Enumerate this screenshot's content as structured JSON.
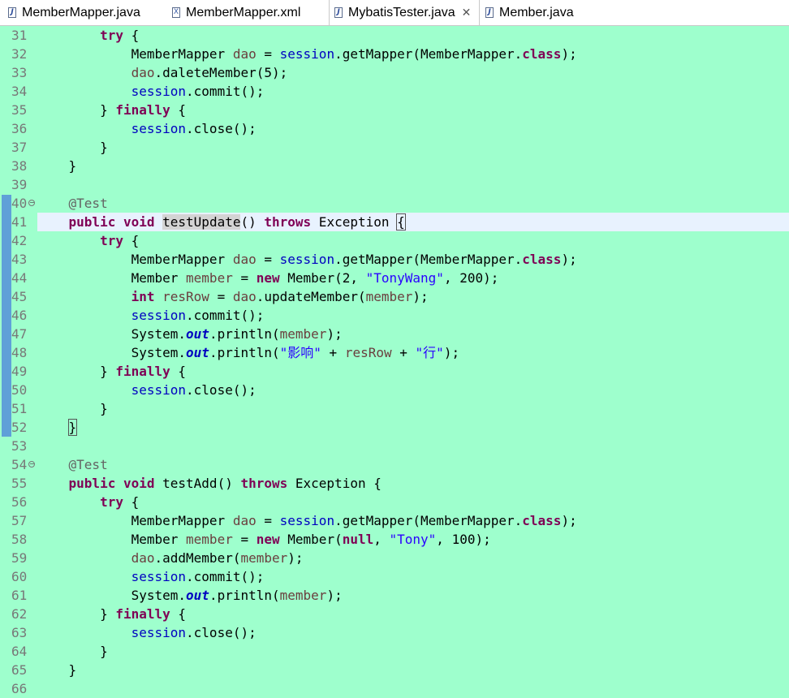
{
  "tabs": [
    {
      "label": "MemberMapper.java",
      "icon": "java-file-icon",
      "active": false,
      "closable": false
    },
    {
      "label": "MemberMapper.xml",
      "icon": "xml-file-icon",
      "active": false,
      "closable": false
    },
    {
      "label": "MybatisTester.java",
      "icon": "java-file-icon",
      "active": true,
      "closable": true
    },
    {
      "label": "Member.java",
      "icon": "java-file-icon",
      "active": false,
      "closable": false
    }
  ],
  "editor": {
    "current_line": 41,
    "background": "#9effcd",
    "lines": [
      {
        "n": "31",
        "tokens": [
          [
            "",
            "        "
          ],
          [
            "kw",
            "try"
          ],
          [
            "",
            " {"
          ]
        ]
      },
      {
        "n": "32",
        "tokens": [
          [
            "",
            "            MemberMapper "
          ],
          [
            "var",
            "dao"
          ],
          [
            "",
            " = "
          ],
          [
            "fld",
            "session"
          ],
          [
            "",
            ".getMapper(MemberMapper."
          ],
          [
            "kw",
            "class"
          ],
          [
            "",
            ");"
          ]
        ]
      },
      {
        "n": "33",
        "tokens": [
          [
            "",
            "            "
          ],
          [
            "var",
            "dao"
          ],
          [
            "",
            ".daleteMember(5);"
          ]
        ]
      },
      {
        "n": "34",
        "tokens": [
          [
            "",
            "            "
          ],
          [
            "fld",
            "session"
          ],
          [
            "",
            ".commit();"
          ]
        ]
      },
      {
        "n": "35",
        "tokens": [
          [
            "",
            "        } "
          ],
          [
            "kw",
            "finally"
          ],
          [
            "",
            " {"
          ]
        ]
      },
      {
        "n": "36",
        "tokens": [
          [
            "",
            "            "
          ],
          [
            "fld",
            "session"
          ],
          [
            "",
            ".close();"
          ]
        ]
      },
      {
        "n": "37",
        "tokens": [
          [
            "",
            "        }"
          ]
        ]
      },
      {
        "n": "38",
        "tokens": [
          [
            "",
            "    }"
          ]
        ]
      },
      {
        "n": "39",
        "tokens": []
      },
      {
        "n": "40",
        "fold": true,
        "tokens": [
          [
            "",
            "    "
          ],
          [
            "annot",
            "@Test"
          ]
        ]
      },
      {
        "n": "41",
        "tokens": [
          [
            "",
            "    "
          ],
          [
            "kw",
            "public"
          ],
          [
            "",
            " "
          ],
          [
            "kw",
            "void"
          ],
          [
            "",
            " "
          ],
          [
            "hl",
            "testUpdate"
          ],
          [
            "",
            "() "
          ],
          [
            "kw",
            "throws"
          ],
          [
            "",
            " Exception "
          ],
          [
            "brk",
            "{"
          ]
        ]
      },
      {
        "n": "42",
        "tokens": [
          [
            "",
            "        "
          ],
          [
            "kw",
            "try"
          ],
          [
            "",
            " {"
          ]
        ]
      },
      {
        "n": "43",
        "tokens": [
          [
            "",
            "            MemberMapper "
          ],
          [
            "var",
            "dao"
          ],
          [
            "",
            " = "
          ],
          [
            "fld",
            "session"
          ],
          [
            "",
            ".getMapper(MemberMapper."
          ],
          [
            "kw",
            "class"
          ],
          [
            "",
            ");"
          ]
        ]
      },
      {
        "n": "44",
        "tokens": [
          [
            "",
            "            Member "
          ],
          [
            "var",
            "member"
          ],
          [
            "",
            " = "
          ],
          [
            "kw",
            "new"
          ],
          [
            "",
            " Member(2, "
          ],
          [
            "str",
            "\"TonyWang\""
          ],
          [
            "",
            ", 200);"
          ]
        ]
      },
      {
        "n": "45",
        "tokens": [
          [
            "",
            "            "
          ],
          [
            "kw",
            "int"
          ],
          [
            "",
            " "
          ],
          [
            "var",
            "resRow"
          ],
          [
            "",
            " = "
          ],
          [
            "var",
            "dao"
          ],
          [
            "",
            ".updateMember("
          ],
          [
            "var",
            "member"
          ],
          [
            "",
            ");"
          ]
        ]
      },
      {
        "n": "46",
        "tokens": [
          [
            "",
            "            "
          ],
          [
            "fld",
            "session"
          ],
          [
            "",
            ".commit();"
          ]
        ]
      },
      {
        "n": "47",
        "tokens": [
          [
            "",
            "            System."
          ],
          [
            "sfld",
            "out"
          ],
          [
            "",
            ".println("
          ],
          [
            "var",
            "member"
          ],
          [
            "",
            ");"
          ]
        ]
      },
      {
        "n": "48",
        "tokens": [
          [
            "",
            "            System."
          ],
          [
            "sfld",
            "out"
          ],
          [
            "",
            ".println("
          ],
          [
            "str",
            "\"影响\""
          ],
          [
            "",
            " + "
          ],
          [
            "var",
            "resRow"
          ],
          [
            "",
            " + "
          ],
          [
            "str",
            "\"行\""
          ],
          [
            "",
            ");"
          ]
        ]
      },
      {
        "n": "49",
        "tokens": [
          [
            "",
            "        } "
          ],
          [
            "kw",
            "finally"
          ],
          [
            "",
            " {"
          ]
        ]
      },
      {
        "n": "50",
        "tokens": [
          [
            "",
            "            "
          ],
          [
            "fld",
            "session"
          ],
          [
            "",
            ".close();"
          ]
        ]
      },
      {
        "n": "51",
        "tokens": [
          [
            "",
            "        }"
          ]
        ]
      },
      {
        "n": "52",
        "tokens": [
          [
            "",
            "    "
          ],
          [
            "brk",
            "}"
          ]
        ]
      },
      {
        "n": "53",
        "tokens": []
      },
      {
        "n": "54",
        "fold": true,
        "tokens": [
          [
            "",
            "    "
          ],
          [
            "annot",
            "@Test"
          ]
        ]
      },
      {
        "n": "55",
        "tokens": [
          [
            "",
            "    "
          ],
          [
            "kw",
            "public"
          ],
          [
            "",
            " "
          ],
          [
            "kw",
            "void"
          ],
          [
            "",
            " testAdd() "
          ],
          [
            "kw",
            "throws"
          ],
          [
            "",
            " Exception {"
          ]
        ]
      },
      {
        "n": "56",
        "tokens": [
          [
            "",
            "        "
          ],
          [
            "kw",
            "try"
          ],
          [
            "",
            " {"
          ]
        ]
      },
      {
        "n": "57",
        "tokens": [
          [
            "",
            "            MemberMapper "
          ],
          [
            "var",
            "dao"
          ],
          [
            "",
            " = "
          ],
          [
            "fld",
            "session"
          ],
          [
            "",
            ".getMapper(MemberMapper."
          ],
          [
            "kw",
            "class"
          ],
          [
            "",
            ");"
          ]
        ]
      },
      {
        "n": "58",
        "tokens": [
          [
            "",
            "            Member "
          ],
          [
            "var",
            "member"
          ],
          [
            "",
            " = "
          ],
          [
            "kw",
            "new"
          ],
          [
            "",
            " Member("
          ],
          [
            "kw",
            "null"
          ],
          [
            "",
            ", "
          ],
          [
            "str",
            "\"Tony\""
          ],
          [
            "",
            ", 100);"
          ]
        ]
      },
      {
        "n": "59",
        "tokens": [
          [
            "",
            "            "
          ],
          [
            "var",
            "dao"
          ],
          [
            "",
            ".addMember("
          ],
          [
            "var",
            "member"
          ],
          [
            "",
            ");"
          ]
        ]
      },
      {
        "n": "60",
        "tokens": [
          [
            "",
            "            "
          ],
          [
            "fld",
            "session"
          ],
          [
            "",
            ".commit();"
          ]
        ]
      },
      {
        "n": "61",
        "tokens": [
          [
            "",
            "            System."
          ],
          [
            "sfld",
            "out"
          ],
          [
            "",
            ".println("
          ],
          [
            "var",
            "member"
          ],
          [
            "",
            ");"
          ]
        ]
      },
      {
        "n": "62",
        "tokens": [
          [
            "",
            "        } "
          ],
          [
            "kw",
            "finally"
          ],
          [
            "",
            " {"
          ]
        ]
      },
      {
        "n": "63",
        "tokens": [
          [
            "",
            "            "
          ],
          [
            "fld",
            "session"
          ],
          [
            "",
            ".close();"
          ]
        ]
      },
      {
        "n": "64",
        "tokens": [
          [
            "",
            "        }"
          ]
        ]
      },
      {
        "n": "65",
        "tokens": [
          [
            "",
            "    }"
          ]
        ]
      },
      {
        "n": "66",
        "tokens": []
      }
    ]
  }
}
